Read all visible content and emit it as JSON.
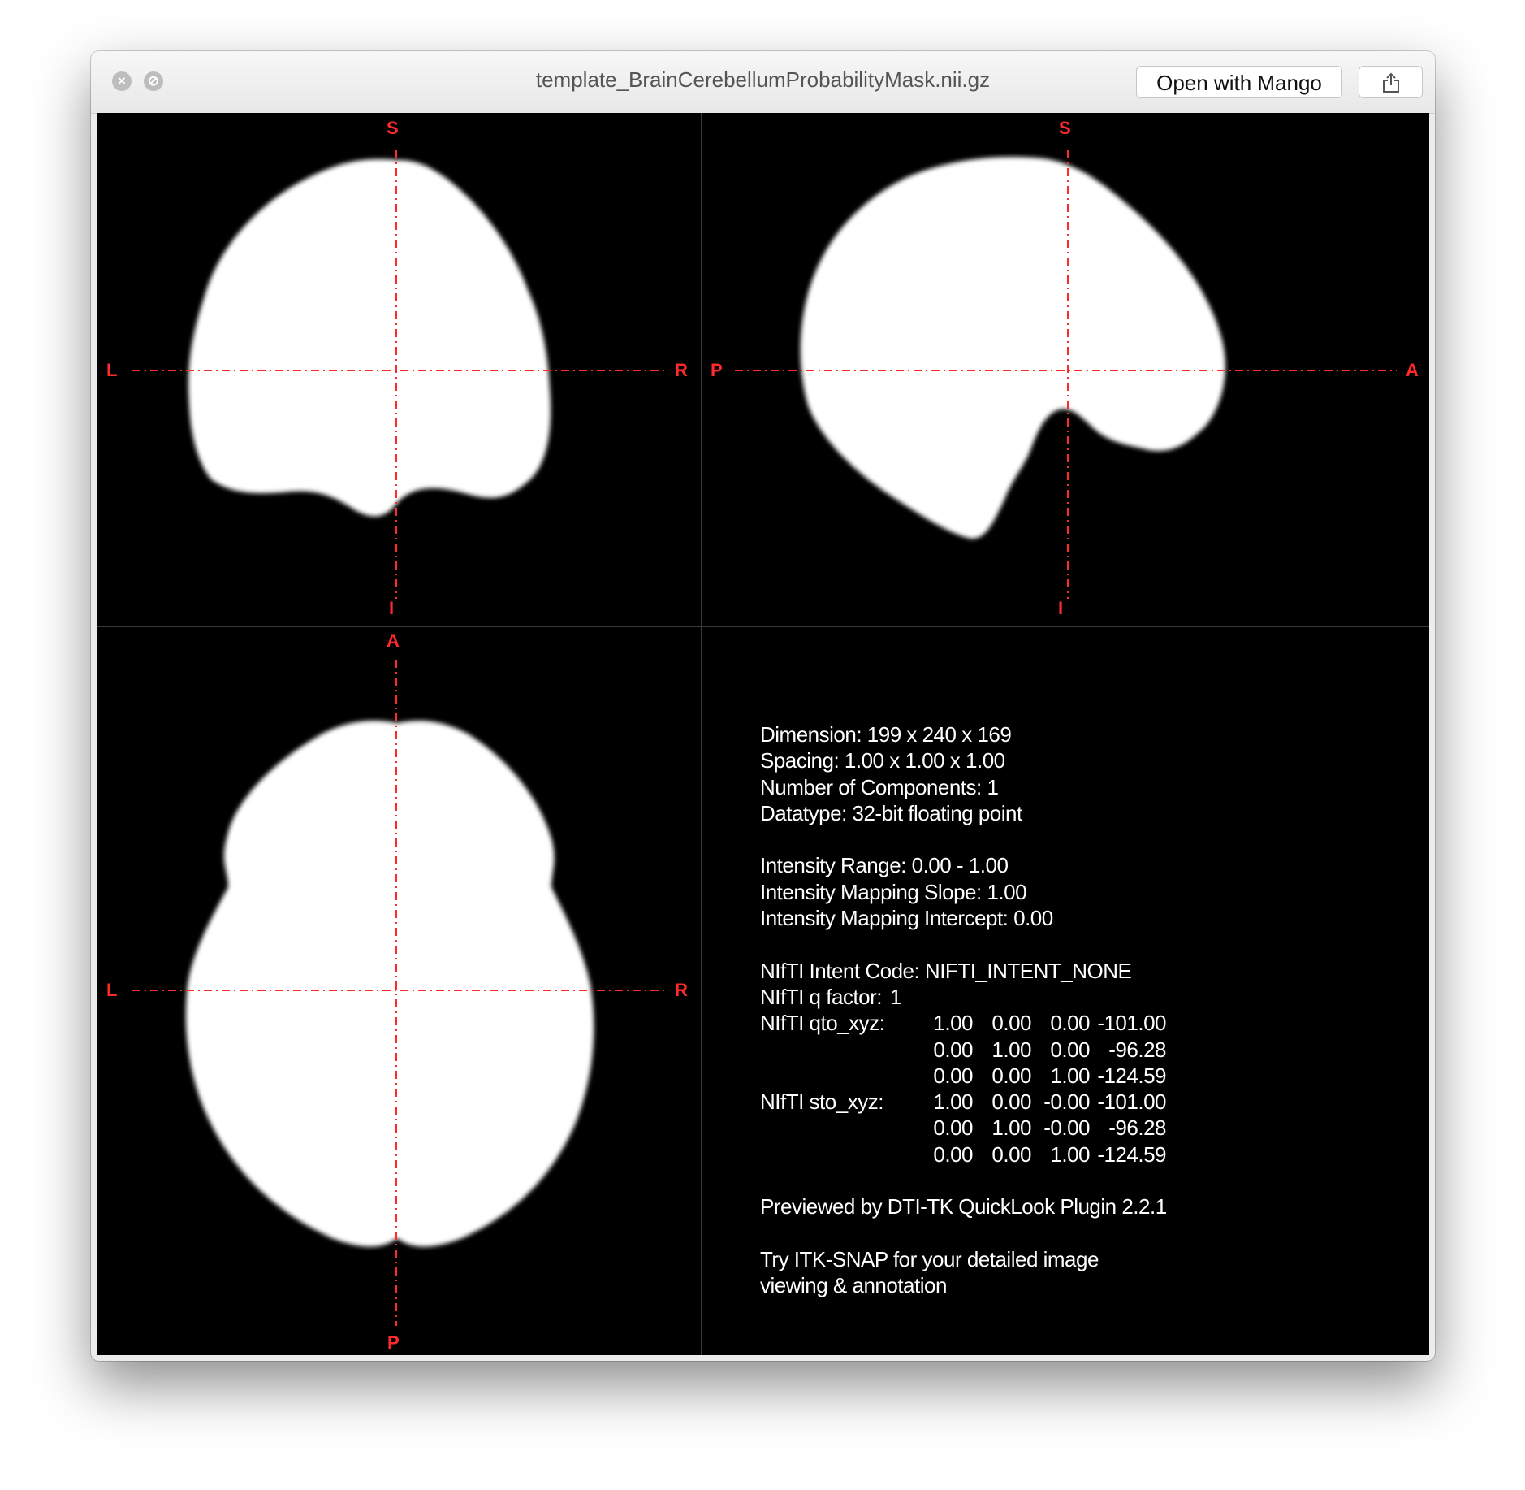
{
  "window": {
    "title": "template_BrainCerebellumProbabilityMask.nii.gz",
    "open_button_label": "Open with Mango"
  },
  "views": {
    "coronal": {
      "top": "S",
      "bottom": "I",
      "left": "L",
      "right": "R"
    },
    "sagittal": {
      "top": "S",
      "bottom": "I",
      "left": "P",
      "right": "A"
    },
    "axial": {
      "top": "A",
      "bottom": "P",
      "left": "L",
      "right": "R"
    }
  },
  "info": {
    "dimension": "Dimension: 199 x 240 x 169",
    "spacing": "Spacing: 1.00 x 1.00 x 1.00",
    "components": "Number of Components: 1",
    "datatype": "Datatype: 32-bit floating point",
    "intensity_range": "Intensity Range: 0.00 - 1.00",
    "mapping_slope": "Intensity Mapping Slope: 1.00",
    "mapping_intercept": "Intensity Mapping Intercept: 0.00",
    "intent_code": "NIfTI Intent Code: NIFTI_INTENT_NONE",
    "q_factor_label": "NIfTI q factor:",
    "q_factor_value": "1",
    "qto_label": "NIfTI qto_xyz:",
    "qto": [
      [
        "1.00",
        "0.00",
        "0.00",
        "-101.00"
      ],
      [
        "0.00",
        "1.00",
        "0.00",
        "-96.28"
      ],
      [
        "0.00",
        "0.00",
        "1.00",
        "-124.59"
      ]
    ],
    "sto_label": "NIfTI sto_xyz:",
    "sto": [
      [
        "1.00",
        "0.00",
        "-0.00",
        "-101.00"
      ],
      [
        "0.00",
        "1.00",
        "-0.00",
        "-96.28"
      ],
      [
        "0.00",
        "0.00",
        "1.00",
        "-124.59"
      ]
    ],
    "previewed_by": "Previewed by DTI-TK QuickLook Plugin 2.2.1",
    "try_line1": "Try ITK-SNAP for your detailed image",
    "try_line2": "viewing & annotation"
  },
  "colors": {
    "crosshair": "#ff2a2a",
    "mask": "#ffffff",
    "background": "#000000"
  }
}
